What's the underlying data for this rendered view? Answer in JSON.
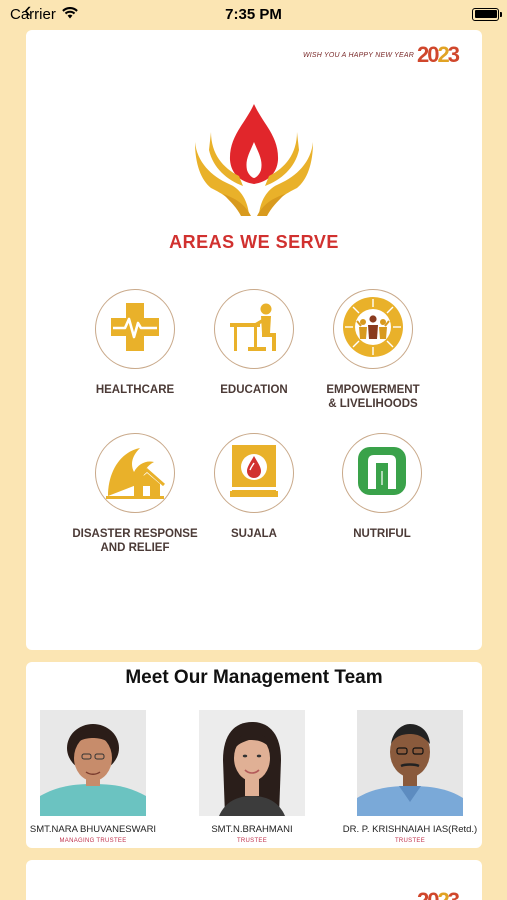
{
  "status_bar": {
    "carrier": "Carrier",
    "time": "7:35 PM"
  },
  "banner": {
    "greeting": "WISH YOU A HAPPY NEW YEAR",
    "year_a": "20",
    "year_b": "2",
    "year_c": "3"
  },
  "areas": {
    "title": "AREAS WE SERVE",
    "items": [
      {
        "label": "HEALTHCARE",
        "icon": "healthcare-icon"
      },
      {
        "label": "EDUCATION",
        "icon": "education-icon"
      },
      {
        "label": "EMPOWERMENT\n& LIVELIHOODS",
        "icon": "empowerment-icon"
      },
      {
        "label": "DISASTER RESPONSE\nAND RELIEF",
        "icon": "disaster-relief-icon"
      },
      {
        "label": "SUJALA",
        "icon": "sujala-icon"
      },
      {
        "label": "NUTRIFUL",
        "icon": "nutriful-icon"
      }
    ]
  },
  "team": {
    "title": "Meet Our Management Team",
    "members": [
      {
        "name": "SMT.NARA BHUVANESWARI",
        "role": "MANAGING TRUSTEE"
      },
      {
        "name": "SMT.N.BRAHMANI",
        "role": "TRUSTEE"
      },
      {
        "name": "DR. P. KRISHNAIAH IAS(Retd.)",
        "role": "TRUSTEE"
      }
    ]
  },
  "colors": {
    "background": "#fbe5b3",
    "accent_red": "#d1312f",
    "accent_gold": "#e9b12a"
  }
}
